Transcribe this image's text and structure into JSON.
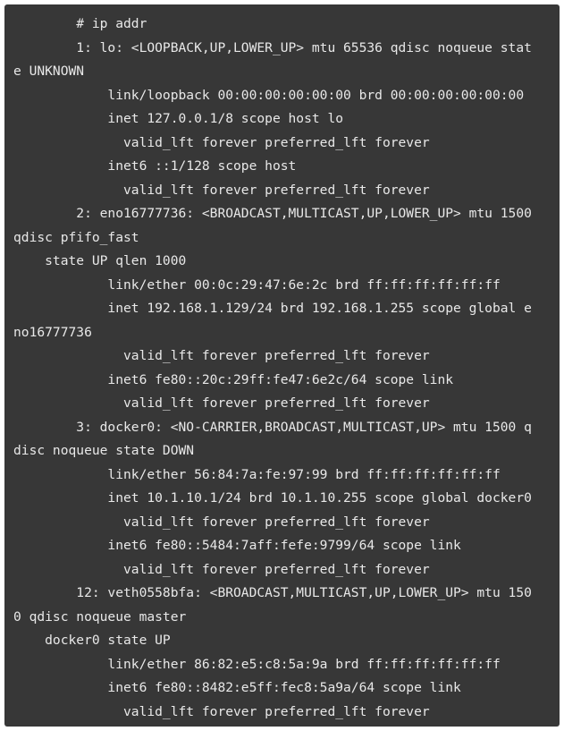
{
  "terminal": {
    "lines": [
      "        # ip addr",
      "        1: lo: <LOOPBACK,UP,LOWER_UP> mtu 65536 qdisc noqueue stat",
      "e UNKNOWN",
      "            link/loopback 00:00:00:00:00:00 brd 00:00:00:00:00:00",
      "            inet 127.0.0.1/8 scope host lo",
      "              valid_lft forever preferred_lft forever",
      "            inet6 ::1/128 scope host",
      "              valid_lft forever preferred_lft forever",
      "        2: eno16777736: <BROADCAST,MULTICAST,UP,LOWER_UP> mtu 1500",
      "qdisc pfifo_fast",
      "    state UP qlen 1000",
      "            link/ether 00:0c:29:47:6e:2c brd ff:ff:ff:ff:ff:ff",
      "            inet 192.168.1.129/24 brd 192.168.1.255 scope global e",
      "no16777736",
      "              valid_lft forever preferred_lft forever",
      "            inet6 fe80::20c:29ff:fe47:6e2c/64 scope link",
      "              valid_lft forever preferred_lft forever",
      "        3: docker0: <NO-CARRIER,BROADCAST,MULTICAST,UP> mtu 1500 q",
      "disc noqueue state DOWN",
      "            link/ether 56:84:7a:fe:97:99 brd ff:ff:ff:ff:ff:ff",
      "            inet 10.1.10.1/24 brd 10.1.10.255 scope global docker0",
      "              valid_lft forever preferred_lft forever",
      "            inet6 fe80::5484:7aff:fefe:9799/64 scope link",
      "              valid_lft forever preferred_lft forever",
      "        12: veth0558bfa: <BROADCAST,MULTICAST,UP,LOWER_UP> mtu 150",
      "0 qdisc noqueue master",
      "    docker0 state UP",
      "            link/ether 86:82:e5:c8:5a:9a brd ff:ff:ff:ff:ff:ff",
      "            inet6 fe80::8482:e5ff:fec8:5a9a/64 scope link",
      "              valid_lft forever preferred_lft forever"
    ]
  }
}
